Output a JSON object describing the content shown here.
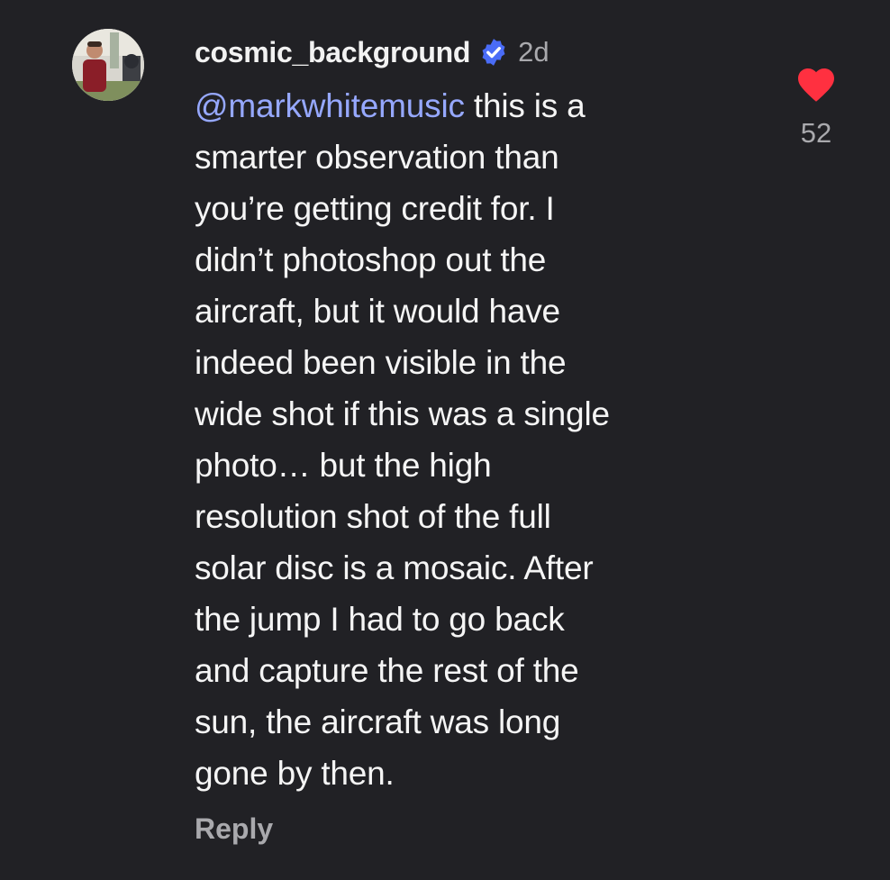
{
  "comment": {
    "username": "cosmic_background",
    "verified": true,
    "timestamp": "2d",
    "mention": "@markwhitemusic",
    "lines": [
      " this is a",
      "smarter observation than",
      "you’re getting credit for. I",
      "didn’t photoshop out the",
      "aircraft, but it would have",
      "indeed been visible in the",
      "wide shot if this was a single",
      "photo… but the high",
      "resolution shot of the full",
      "solar disc is a mosaic. After",
      "the jump I had to go back",
      "and capture the rest of the",
      "sun, the aircraft was long",
      "gone by then."
    ],
    "reply_label": "Reply",
    "like_count": "52",
    "liked": true
  },
  "colors": {
    "background": "#212125",
    "text": "#f5f5f5",
    "muted": "#a9a9ad",
    "mention": "#96a8ff",
    "verified_badge": "#4a6cf7",
    "heart": "#ff3040"
  },
  "icons": {
    "verified": "verified-badge-icon",
    "like": "heart-icon"
  }
}
